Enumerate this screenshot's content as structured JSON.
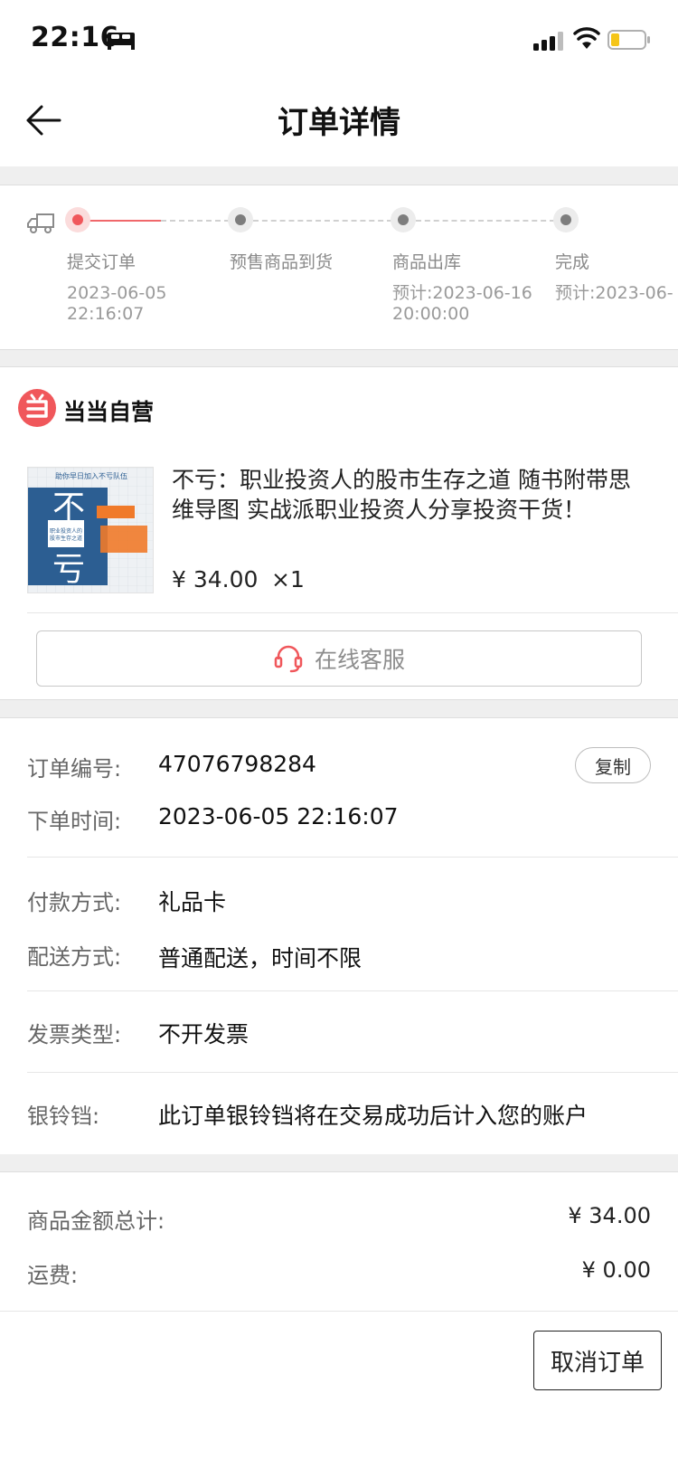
{
  "status_bar": {
    "time": "22:16"
  },
  "nav": {
    "title": "订单详情"
  },
  "progress": {
    "steps": [
      {
        "label": "提交订单",
        "date": "2023-06-05\n22:16:07"
      },
      {
        "label": "预售商品到货",
        "date": ""
      },
      {
        "label": "商品出库",
        "date": "预计:2023-06-16\n20:00:00"
      },
      {
        "label": "完成",
        "date": "预计:2023-06-"
      }
    ]
  },
  "shop": {
    "name": "当当自营"
  },
  "product": {
    "title": "不亏：职业投资人的股市生存之道 随书附带思维导图 实战派职业投资人分享投资干货！",
    "price": "¥ 34.00",
    "quantity": "×1",
    "cover_text": {
      "top": "助你早日加入不亏队伍，实现财务自由！",
      "big1": "不",
      "big2": "亏",
      "sub": "职业投资人的股市生存之道",
      "tag": "实战派职业投资人分享投资干货"
    }
  },
  "service": {
    "label": "在线客服"
  },
  "order_info": {
    "order_no_label": "订单编号:",
    "order_no": "47076798284",
    "copy_label": "复制",
    "order_time_label": "下单时间:",
    "order_time": "2023-06-05 22:16:07",
    "payment_label": "付款方式:",
    "payment": "礼品卡",
    "delivery_label": "配送方式:",
    "delivery": "普通配送，时间不限",
    "invoice_label": "发票类型:",
    "invoice": "不开发票",
    "bell_label": "银铃铛:",
    "bell": "此订单银铃铛将在交易成功后计入您的账户"
  },
  "totals": {
    "goods_label": "商品金额总计:",
    "goods_value": "¥ 34.00",
    "shipping_label": "运费:",
    "shipping_value": "¥ 0.00"
  },
  "actions": {
    "cancel_label": "取消订单"
  },
  "colors": {
    "accent": "#f0575b",
    "gap": "#efefef"
  }
}
